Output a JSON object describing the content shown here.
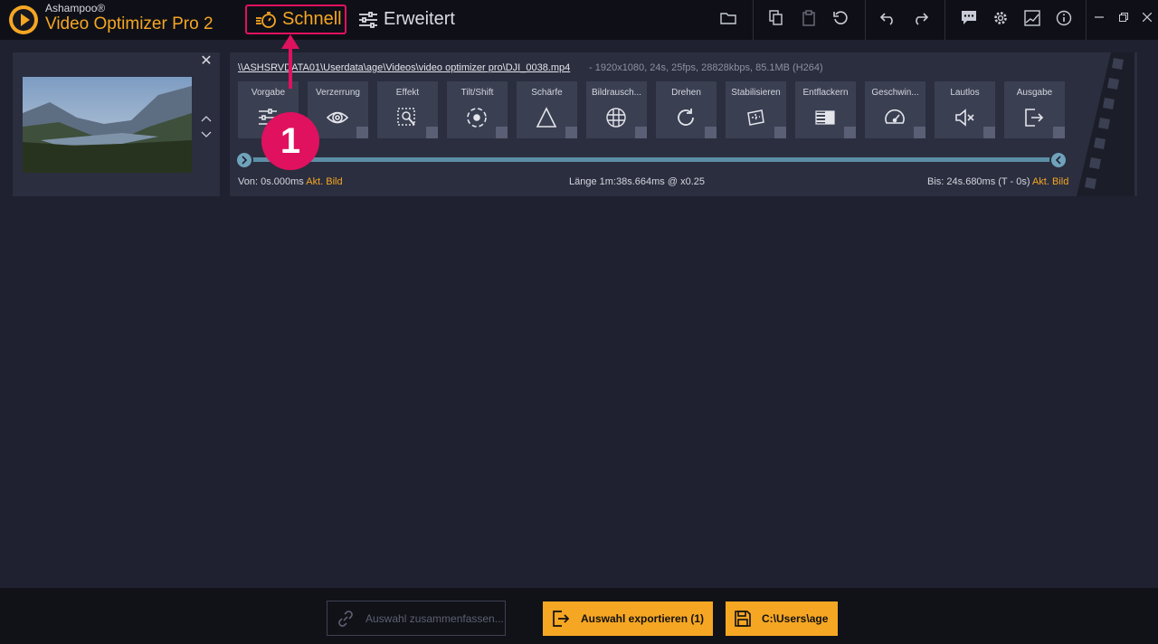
{
  "app": {
    "brand_small": "Ashampoo®",
    "brand_title": "Video Optimizer Pro 2"
  },
  "modes": {
    "schnell": "Schnell",
    "erweitert": "Erweitert"
  },
  "annotation": {
    "step_number": "1"
  },
  "clip": {
    "path": "\\\\ASHSRVDATA01\\Userdata\\age\\Videos\\video optimizer pro\\DJI_0038.mp4",
    "info": "-   1920x1080, 24s, 25fps, 28828kbps, 85.1MB (H264)",
    "tools": [
      {
        "label": "Vorgabe",
        "icon": "sliders-icon"
      },
      {
        "label": "Verzerrung",
        "icon": "eye-icon"
      },
      {
        "label": "Effekt",
        "icon": "effect-icon"
      },
      {
        "label": "Tilt/Shift",
        "icon": "tilt-shift-icon"
      },
      {
        "label": "Schärfe",
        "icon": "triangle-icon"
      },
      {
        "label": "Bildrausch...",
        "icon": "noise-icon"
      },
      {
        "label": "Drehen",
        "icon": "rotate-icon"
      },
      {
        "label": "Stabilisieren",
        "icon": "stabilize-icon"
      },
      {
        "label": "Entflackern",
        "icon": "deflicker-icon"
      },
      {
        "label": "Geschwin...",
        "icon": "speedometer-icon"
      },
      {
        "label": "Lautlos",
        "icon": "mute-icon"
      },
      {
        "label": "Ausgabe",
        "icon": "output-icon"
      }
    ],
    "from_label": "Von:",
    "from_value": "0s.000ms",
    "from_current": "Akt. Bild",
    "length_label": "Länge",
    "length_value": "1m:38s.664ms @ x0.25",
    "to_label": "Bis:",
    "to_value": "24s.680ms (T - 0s)",
    "to_current": "Akt. Bild"
  },
  "footer": {
    "merge_label": "Auswahl zusammenfassen...",
    "export_label": "Auswahl exportieren (1)",
    "path_label": "C:\\Users\\age"
  },
  "colors": {
    "accent": "#f5a623",
    "highlight": "#e0115f",
    "background": "#1f2130",
    "panel": "#2b2e3f"
  }
}
